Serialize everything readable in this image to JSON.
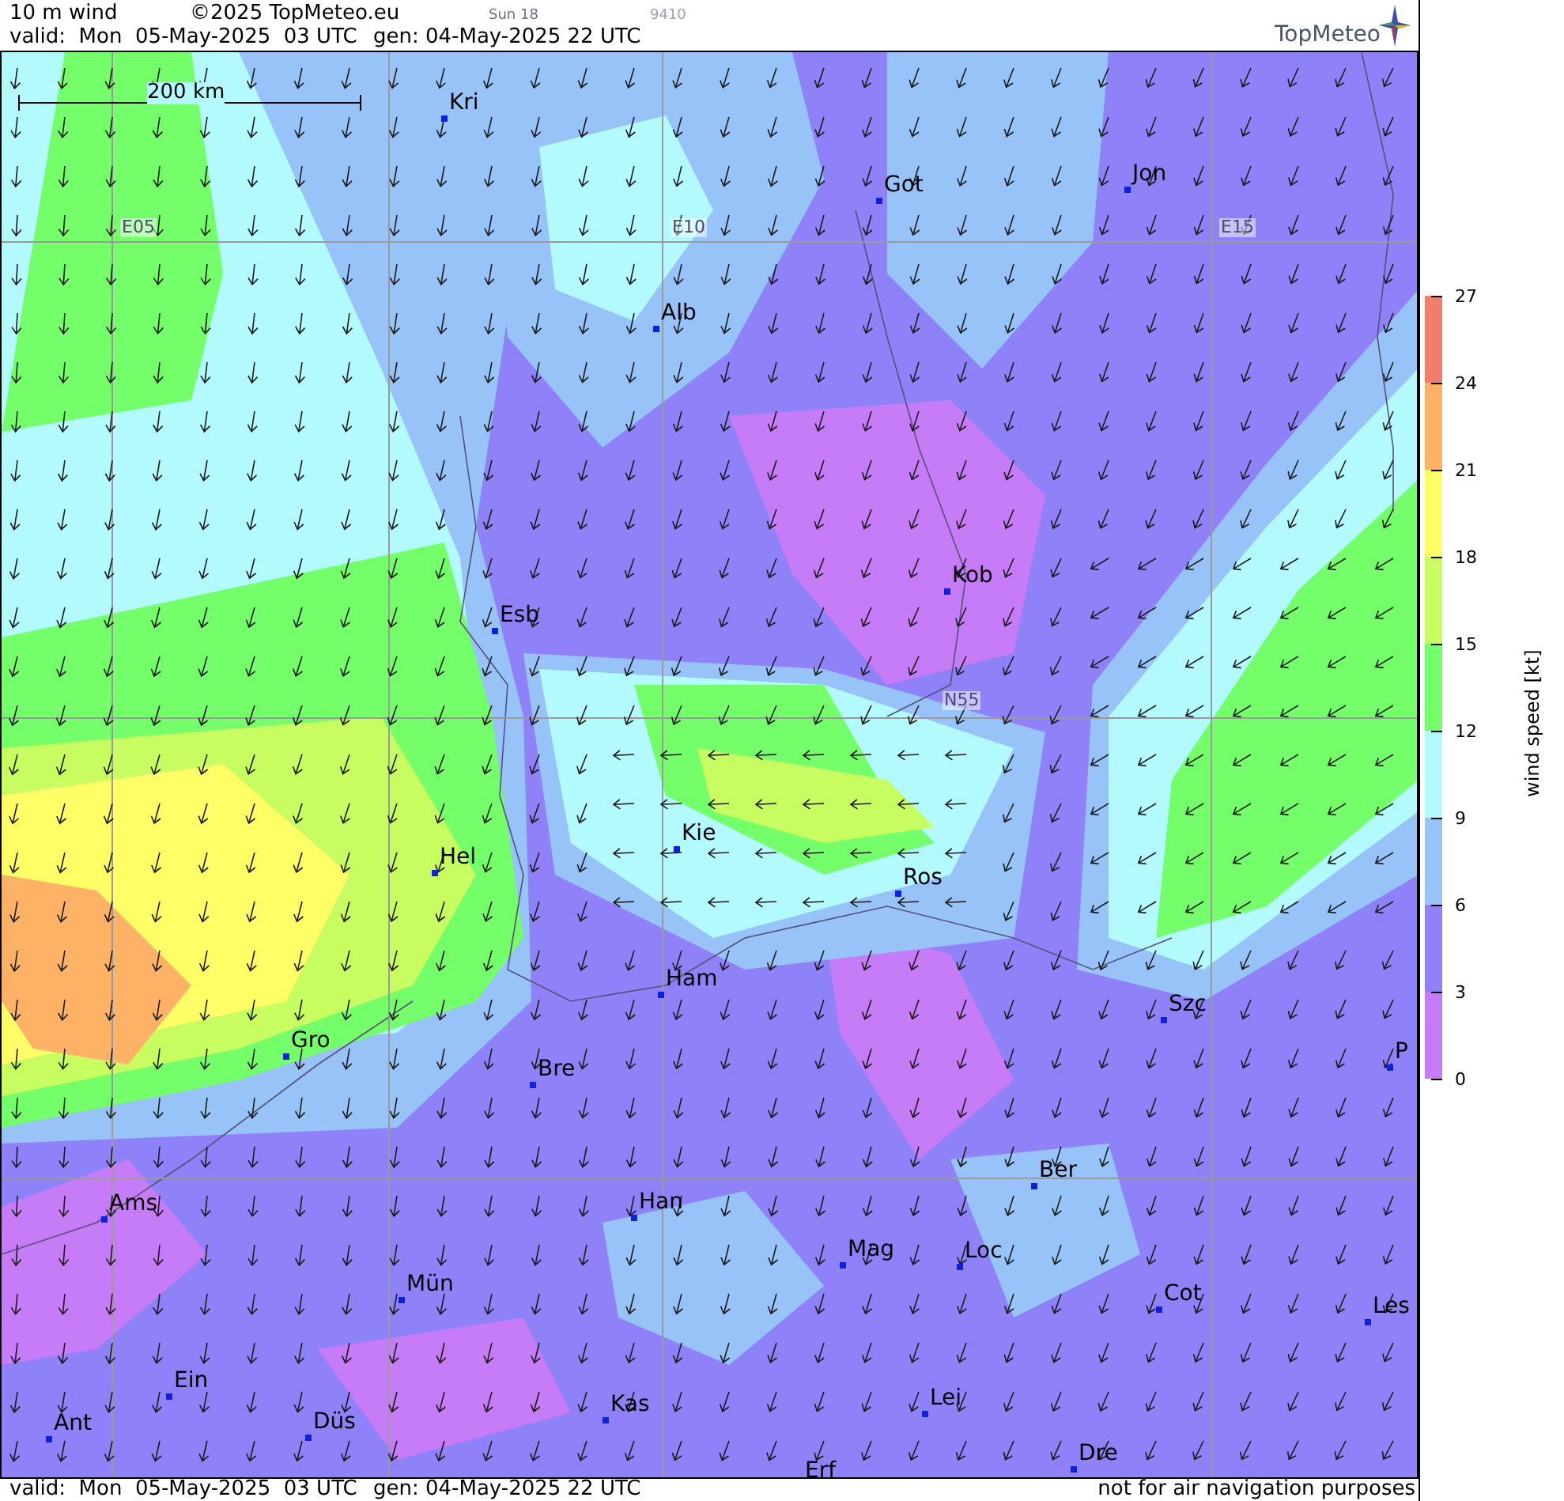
{
  "header": {
    "title": "10 m wind",
    "copyright": "©2025 TopMeteo.eu",
    "sun": "Sun 18",
    "code": "9410",
    "valid": "valid:  Mon  05-May-2025  03 UTC",
    "generated": "gen: 04-May-2025 22 UTC",
    "logo": "TopMeteo"
  },
  "map": {
    "scale_bar": "200 km",
    "grid_labels": [
      "E05",
      "E10",
      "E15",
      "N55"
    ],
    "cities": [
      "Kri",
      "Got",
      "Jon",
      "Alb",
      "Kob",
      "Esb",
      "Kie",
      "Hel",
      "Ros",
      "Ham",
      "Szc",
      "Gro",
      "Bre",
      "P",
      "Ber",
      "Ams",
      "Han",
      "Mag",
      "Loc",
      "Cot",
      "Les",
      "Mün",
      "Ein",
      "Lei",
      "Kas",
      "Ant",
      "Düs",
      "Dre",
      "Erf"
    ]
  },
  "legend": {
    "title": "wind speed [kt]",
    "ticks": [
      "27",
      "24",
      "21",
      "18",
      "15",
      "12",
      "9",
      "6",
      "3",
      "0"
    ],
    "bins": [
      {
        "color": "#f27d6a"
      },
      {
        "color": "#feb266"
      },
      {
        "color": "#fefe66"
      },
      {
        "color": "#c8fd62"
      },
      {
        "color": "#74fe6a"
      },
      {
        "color": "#b3fafe"
      },
      {
        "color": "#97c3f8"
      },
      {
        "color": "#8f82f8"
      },
      {
        "color": "#c77cf7"
      }
    ]
  },
  "footer": {
    "valid": "valid:  Mon  05-May-2025  03 UTC",
    "generated": "gen: 04-May-2025 22 UTC",
    "notice": "not for air navigation purposes"
  }
}
